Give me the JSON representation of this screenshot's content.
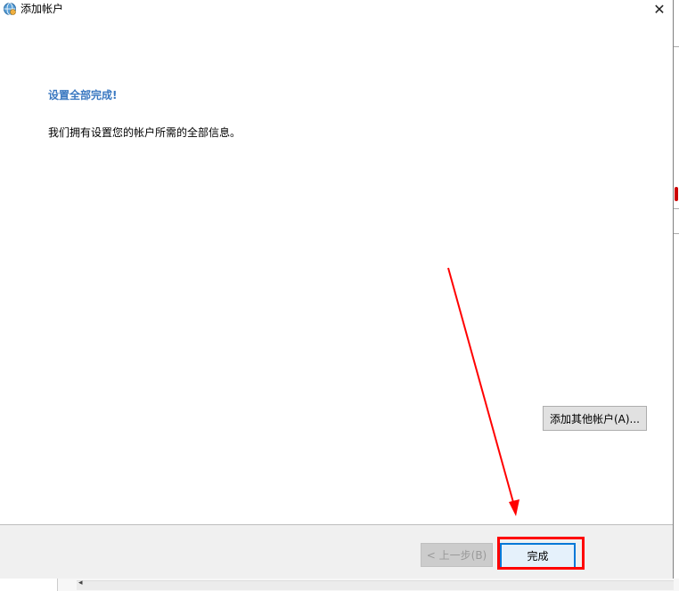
{
  "window": {
    "title": "添加帐户",
    "close_icon": "close-icon",
    "app_icon": "account-globe-icon"
  },
  "main": {
    "heading": "设置全部完成!",
    "description": "我们拥有设置您的帐户所需的全部信息。",
    "add_other_account_label": "添加其他帐户(A)..."
  },
  "footer": {
    "back_label": "< 上一步(B)",
    "finish_label": "完成"
  },
  "annotation": {
    "color": "#ff0000",
    "target": "finish-button"
  },
  "colors": {
    "heading": "#3a78c1",
    "footer_bg": "#f0f0f0",
    "focus_border": "#0078d7"
  }
}
